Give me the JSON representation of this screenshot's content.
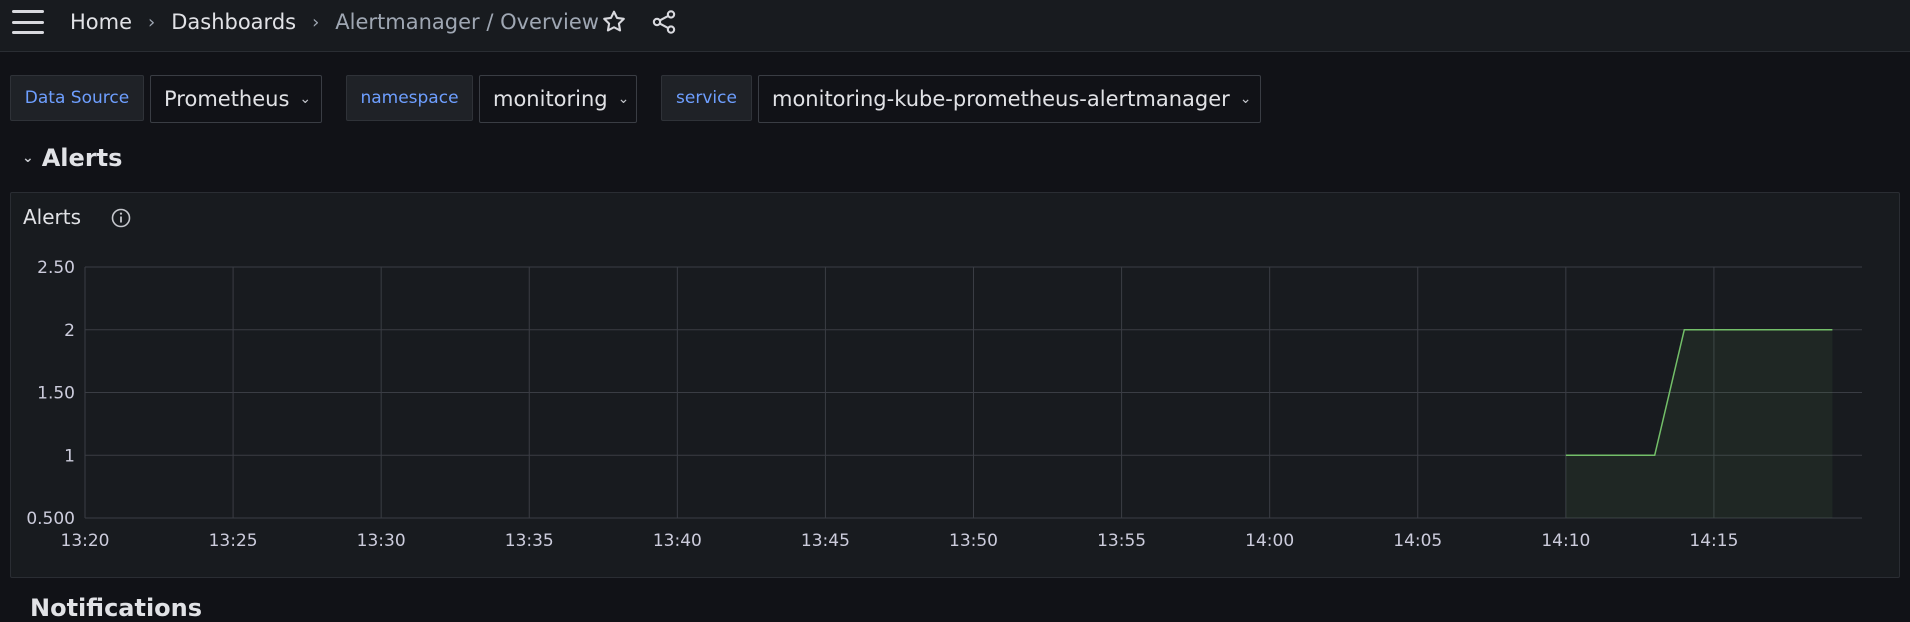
{
  "topbar": {
    "breadcrumb": [
      "Home",
      "Dashboards",
      "Alertmanager / Overview"
    ],
    "separator": "›",
    "icons": [
      "menu-icon",
      "star-icon",
      "share-icon"
    ]
  },
  "variables": [
    {
      "label": "Data Source",
      "value": "Prometheus"
    },
    {
      "label": "namespace",
      "value": "monitoring"
    },
    {
      "label": "service",
      "value": "monitoring-kube-prometheus-alertmanager"
    }
  ],
  "row": {
    "title": "Alerts",
    "next_row_title": "Notifications"
  },
  "panel": {
    "title": "Alerts",
    "info_icon": "info-icon"
  },
  "colors": {
    "series": "#73bf69",
    "grid": "#3a3d44",
    "axis_text": "#ccccdc",
    "label_accent": "#6e9fff"
  },
  "chart_data": {
    "type": "area",
    "title": "Alerts",
    "x_ticks": [
      "13:20",
      "13:25",
      "13:30",
      "13:35",
      "13:40",
      "13:45",
      "13:50",
      "13:55",
      "14:00",
      "14:05",
      "14:10",
      "14:15"
    ],
    "y_ticks": [
      "0.500",
      "1",
      "1.50",
      "2",
      "2.50"
    ],
    "ylim": [
      0.5,
      2.5
    ],
    "xlim": [
      "13:20",
      "14:20"
    ],
    "series": [
      {
        "x": [
          "14:10",
          "14:13",
          "14:14",
          "14:19"
        ],
        "values": [
          1,
          1,
          2,
          2
        ]
      }
    ],
    "grid": true,
    "legend": "none"
  }
}
